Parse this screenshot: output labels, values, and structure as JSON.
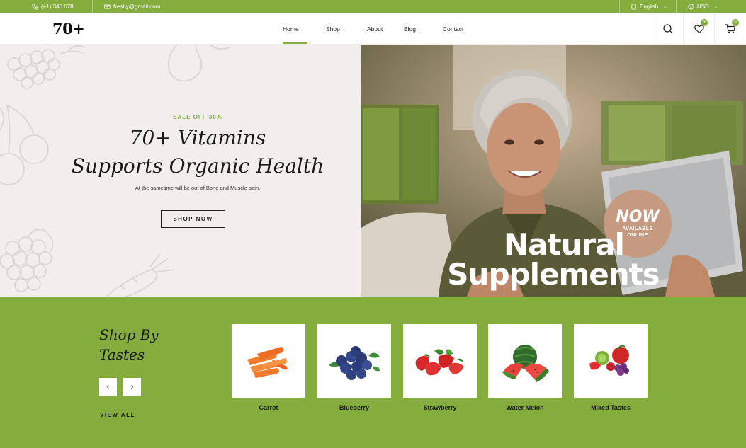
{
  "topbar": {
    "phone": "(+1) 345 678",
    "email": "freshy@gmail.com",
    "language": "English",
    "currency": "USD"
  },
  "header": {
    "logo": "70+",
    "nav": [
      {
        "label": "Home",
        "has_dropdown": true,
        "active": true
      },
      {
        "label": "Shop",
        "has_dropdown": true
      },
      {
        "label": "About",
        "has_dropdown": false
      },
      {
        "label": "Blog",
        "has_dropdown": true
      },
      {
        "label": "Contact",
        "has_dropdown": false
      }
    ],
    "wishlist_count": "3",
    "cart_count": "0",
    "accent": "#84ad3e"
  },
  "hero": {
    "sale": "SALE OFF 30%",
    "title_line1": "70+ Vitamins",
    "title_line2": "Supports Organic Health",
    "subtitle": "At the sametime will be out of Bone and Muscle pain.",
    "cta": "SHOP NOW",
    "banner_line1": "Natural",
    "banner_line2": "Supplements",
    "badge_now": "NOW",
    "badge_available": "AVAILABLE",
    "badge_online": "ONLINE"
  },
  "tastes": {
    "title_line1": "Shop By",
    "title_line2": "Tastes",
    "view_all": "VIEW ALL",
    "prev": "‹",
    "next": "›",
    "items": [
      {
        "label": "Carrot"
      },
      {
        "label": "Blueberry"
      },
      {
        "label": "Strawberry"
      },
      {
        "label": "Water Melon"
      },
      {
        "label": "Mixed Tastes"
      }
    ]
  }
}
